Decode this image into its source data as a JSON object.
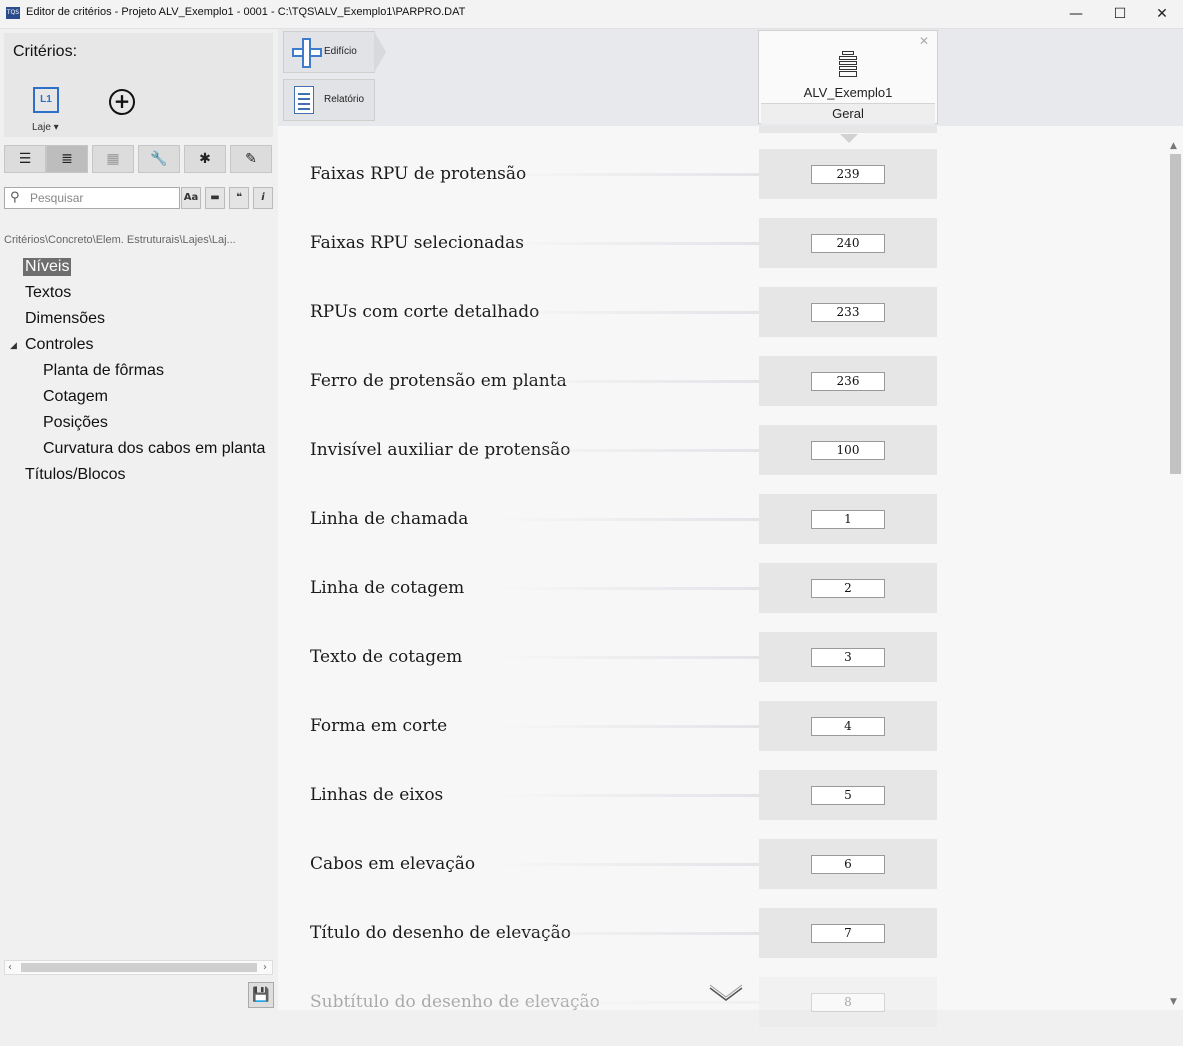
{
  "window": {
    "title": "Editor de critérios - Projeto ALV_Exemplo1 - 0001 - C:\\TQS\\ALV_Exemplo1\\PARPRO.DAT",
    "app_icon_text": "TQS",
    "minimize": "—",
    "maximize": "☐",
    "close": "✕"
  },
  "sidebar": {
    "criteria_title": "Critérios:",
    "laje_icon_text": "L1",
    "laje_label": "Laje ▾",
    "add_symbol": "+",
    "toolbar": [
      {
        "icon": "list-view-icon",
        "glyph": "☰"
      },
      {
        "icon": "detail-view-icon",
        "glyph": "≣"
      },
      {
        "icon": "grid-view-icon",
        "glyph": "▦"
      },
      {
        "icon": "wrench-icon",
        "glyph": "🔧"
      },
      {
        "icon": "asterisk-icon",
        "glyph": "✱"
      },
      {
        "icon": "pencil-icon",
        "glyph": "✎"
      }
    ],
    "search": {
      "placeholder": "Pesquisar",
      "options": [
        "Aa",
        "▬",
        "❝",
        "i"
      ]
    },
    "breadcrumb": "Critérios\\Concreto\\Elem. Estruturais\\Lajes\\Laj...",
    "tree": [
      {
        "label": "Níveis",
        "selected": true
      },
      {
        "label": "Textos"
      },
      {
        "label": "Dimensões"
      },
      {
        "label": "Controles",
        "expanded": true
      },
      {
        "label": "Planta de fôrmas"
      },
      {
        "label": "Cotagem"
      },
      {
        "label": "Posições"
      },
      {
        "label": "Curvatura dos cabos em planta"
      },
      {
        "label": "Títulos/Blocos"
      }
    ],
    "tree_arrow": "◢",
    "scroll_left": "‹",
    "scroll_right": "›",
    "save_glyph": "💾"
  },
  "topbar": {
    "nav_buttons": [
      {
        "label": "Edifício",
        "icon": "building-plus-icon"
      },
      {
        "label": "Relatório",
        "icon": "report-icon"
      }
    ],
    "card": {
      "name": "ALV_Exemplo1",
      "tab": "Geral",
      "close": "✕"
    }
  },
  "rows": [
    {
      "label": "Faixas RPU de protensão",
      "value": "239"
    },
    {
      "label": "Faixas RPU selecionadas",
      "value": "240"
    },
    {
      "label": "RPUs com corte detalhado",
      "value": "233"
    },
    {
      "label": "Ferro de protensão em planta",
      "value": "236"
    },
    {
      "label": "Invisível auxiliar de protensão",
      "value": "100"
    },
    {
      "label": "Linha de chamada",
      "value": "1"
    },
    {
      "label": "Linha de cotagem",
      "value": "2"
    },
    {
      "label": "Texto de cotagem",
      "value": "3"
    },
    {
      "label": "Forma em corte",
      "value": "4"
    },
    {
      "label": "Linhas de eixos",
      "value": "5"
    },
    {
      "label": "Cabos em elevação",
      "value": "6"
    },
    {
      "label": "Título do desenho de elevação",
      "value": "7"
    },
    {
      "label": "Subtítulo do desenho de elevação",
      "value": "8"
    }
  ],
  "vscroll": {
    "up": "▲",
    "down": "▼"
  }
}
